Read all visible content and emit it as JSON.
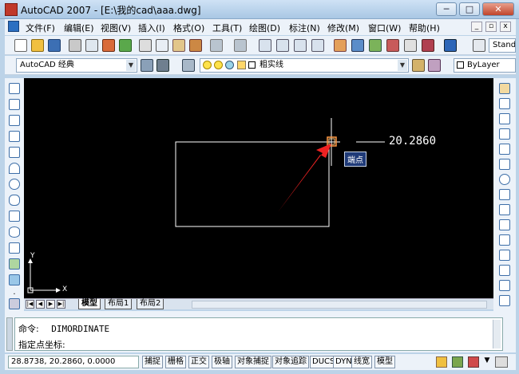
{
  "window": {
    "title": "AutoCAD 2007 - [E:\\我的cad\\aaa.dwg]",
    "controls": {
      "minimize": "─",
      "maximize": "□",
      "close": "✕"
    }
  },
  "menubar": {
    "items": [
      "文件(F)",
      "编辑(E)",
      "视图(V)",
      "插入(I)",
      "格式(O)",
      "工具(T)",
      "绘图(D)",
      "标注(N)",
      "修改(M)",
      "窗口(W)",
      "帮助(H)"
    ],
    "mdi": {
      "minimize": "_",
      "restore": "▫",
      "close": "x"
    }
  },
  "toolbar": {
    "workspace": "AutoCAD 经典",
    "text_style": "Stand",
    "linetype_hint": "粗实线",
    "layer_value": "ByLayer"
  },
  "drawing": {
    "dimension_value": "20.2860",
    "tooltip": "端点",
    "ucs_x": "X",
    "ucs_y": "Y"
  },
  "tabs": {
    "nav": [
      "|◀",
      "◀",
      "▶",
      "▶|"
    ],
    "items": [
      "模型",
      "布局1",
      "布局2"
    ],
    "active": "模型"
  },
  "command": {
    "line1_label": "命令:",
    "line1_value": "DIMORDINATE",
    "line2_label": "指定点坐标:"
  },
  "statusbar": {
    "coordinates": "28.8738, 20.2860, 0.0000",
    "buttons": [
      "捕捉",
      "栅格",
      "正交",
      "极轴",
      "对象捕捉",
      "对象追踪",
      "DUCS",
      "DYN",
      "线宽",
      "模型"
    ]
  },
  "colors": {
    "canvas": "#000000",
    "rectangle": "#ffffff",
    "snap_marker": "#ff9944",
    "arrow": "#ee2222",
    "tooltip_bg": "#1f3a78"
  }
}
